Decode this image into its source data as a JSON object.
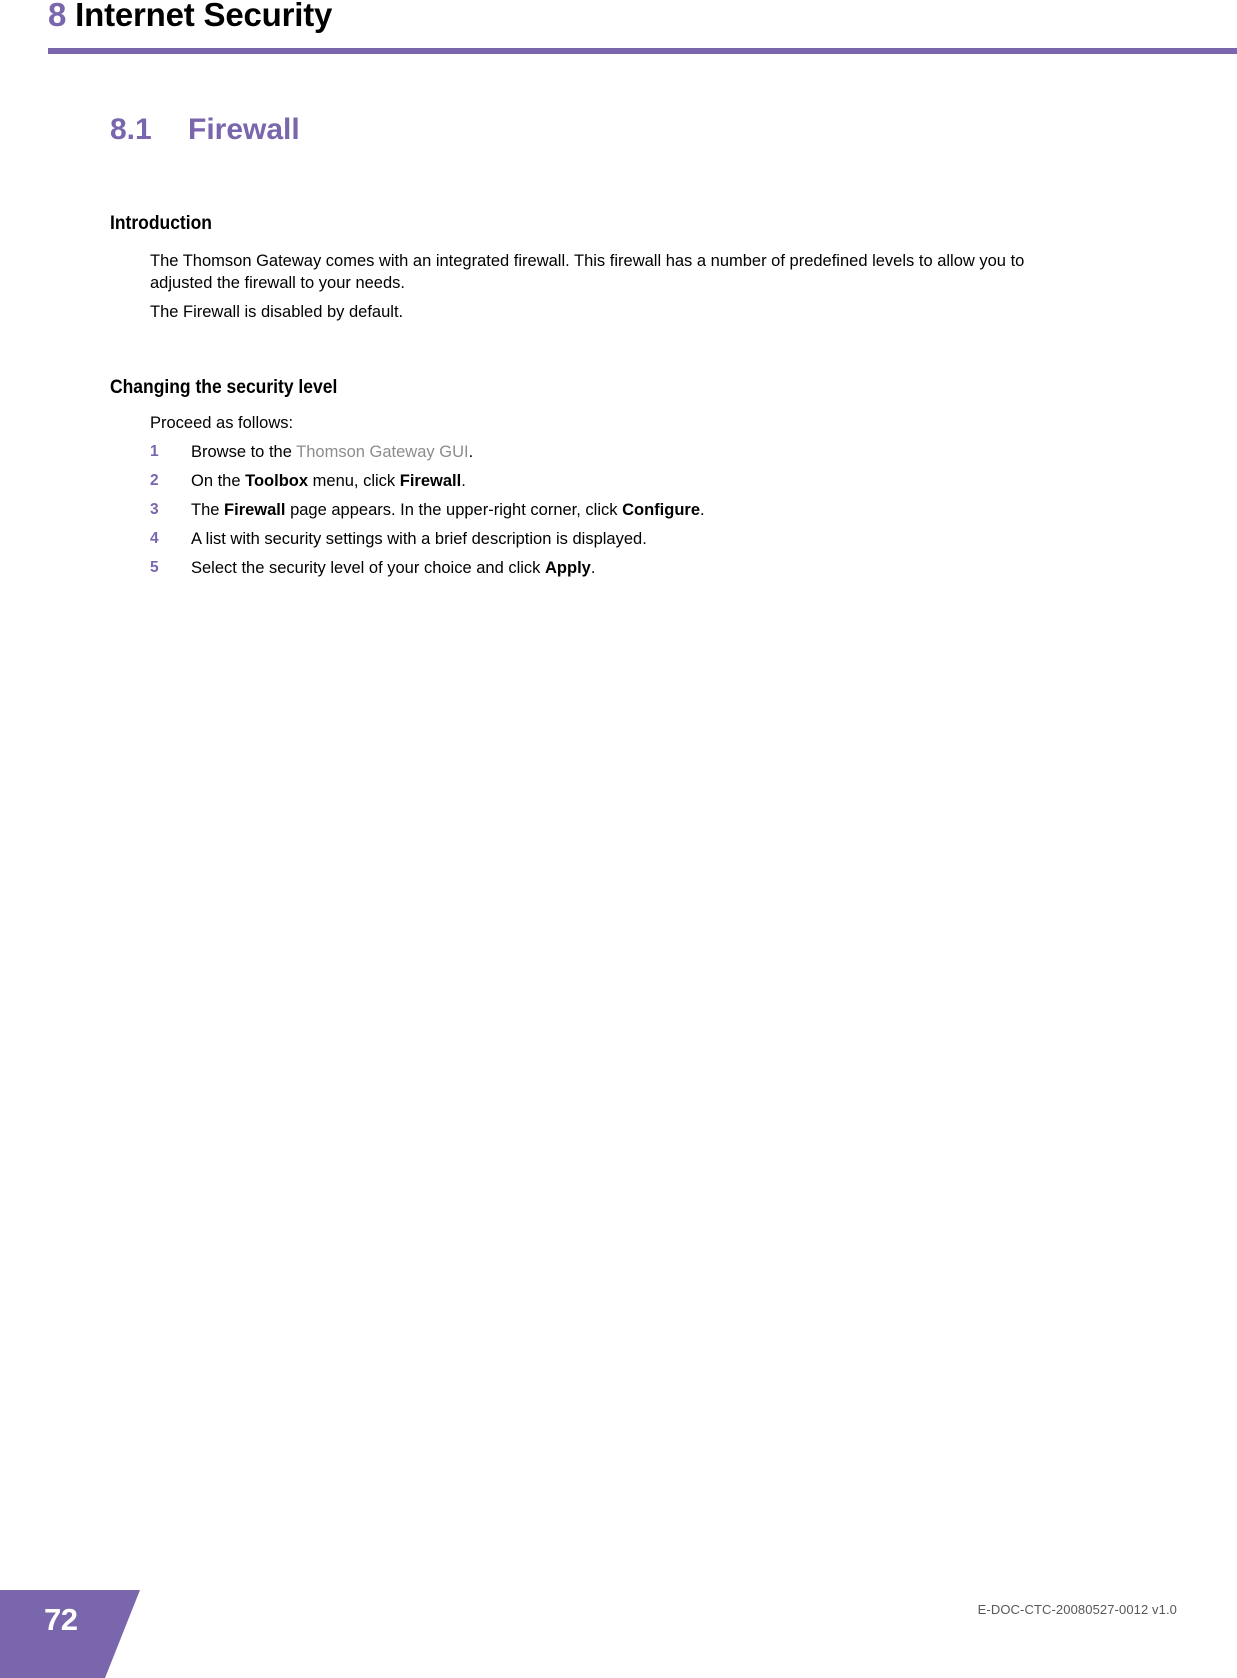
{
  "chapter": {
    "number": "8",
    "title": "Internet Security",
    "accent_color": "#7a66ad"
  },
  "section": {
    "number": "8.1",
    "title": "Firewall"
  },
  "introduction": {
    "heading": "Introduction",
    "paragraph_1": "The Thomson Gateway comes with an integrated firewall. This firewall has a number of predefined levels to allow you to adjusted the firewall to your needs.",
    "paragraph_2": "The Firewall is disabled by default."
  },
  "changing_security_level": {
    "heading": "Changing the security level",
    "intro": "Proceed as follows:",
    "steps": [
      {
        "number": "1",
        "prefix": "Browse to the ",
        "xref": "Thomson Gateway GUI",
        "suffix": "."
      },
      {
        "number": "2",
        "prefix": "On the ",
        "bold_1": "Toolbox",
        "middle": " menu, click ",
        "bold_2": "Firewall",
        "suffix": "."
      },
      {
        "number": "3",
        "prefix": "The ",
        "bold_1": "Firewall",
        "middle": " page appears. In the upper-right corner, click ",
        "bold_2": "Configure",
        "suffix": "."
      },
      {
        "number": "4",
        "prefix": "A list with security settings with a brief description is displayed.",
        "suffix": ""
      },
      {
        "number": "5",
        "prefix": "Select the security level of your choice and click ",
        "bold_1": "Apply",
        "suffix": "."
      }
    ]
  },
  "footer": {
    "page_number": "72",
    "document_id": "E-DOC-CTC-20080527-0012 v1.0"
  }
}
